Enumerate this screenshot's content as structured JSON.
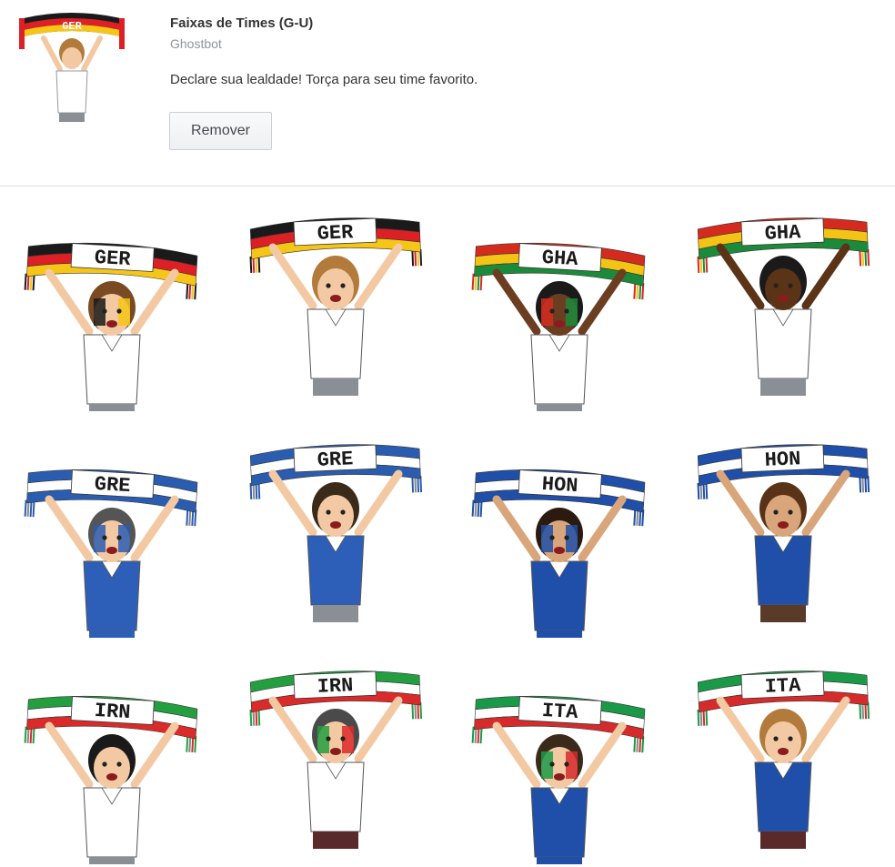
{
  "pack": {
    "title": "Faixas de Times (G-U)",
    "author": "Ghostbot",
    "description": "Declare sua lealdade! Torça para seu time favorito.",
    "remove_label": "Remover",
    "thumbnail_scarf_text": "GER"
  },
  "stickers": [
    {
      "text": "GER",
      "stripes": [
        "#1a1a1a",
        "#dd1f26",
        "#f5c518"
      ],
      "shirt": "#ffffff",
      "pants": "#8a8f96",
      "skin": "#f3c9a4",
      "hair": "#7a4a22",
      "facepaint": true
    },
    {
      "text": "GER",
      "stripes": [
        "#1a1a1a",
        "#dd1f26",
        "#f5c518"
      ],
      "shirt": "#ffffff",
      "pants": "#8a8f96",
      "skin": "#f3c9a4",
      "hair": "#b27b3c",
      "facepaint": false
    },
    {
      "text": "GHA",
      "stripes": [
        "#d52b1e",
        "#f3c316",
        "#1b8a3a"
      ],
      "shirt": "#ffffff",
      "pants": "#8a8f96",
      "skin": "#6b3e22",
      "hair": "#1a1a1a",
      "facepaint": true
    },
    {
      "text": "GHA",
      "stripes": [
        "#d52b1e",
        "#f3c316",
        "#1b8a3a"
      ],
      "shirt": "#ffffff",
      "pants": "#8a8f96",
      "skin": "#5b3418",
      "hair": "#1a1a1a",
      "facepaint": false
    },
    {
      "text": "GRE",
      "stripes": [
        "#2a5db0",
        "#ffffff",
        "#2a5db0"
      ],
      "shirt": "#2e5fb8",
      "pants": "#2e5fb8",
      "skin": "#f3c9a4",
      "hair": "#555555",
      "facepaint": true
    },
    {
      "text": "GRE",
      "stripes": [
        "#2a5db0",
        "#ffffff",
        "#2a5db0"
      ],
      "shirt": "#2e5fb8",
      "pants": "#8a8f96",
      "skin": "#f3c9a4",
      "hair": "#3a2a1a",
      "facepaint": false
    },
    {
      "text": "HON",
      "stripes": [
        "#1f4fa8",
        "#ffffff",
        "#1f4fa8"
      ],
      "shirt": "#1f4fa8",
      "pants": "#1f4fa8",
      "skin": "#d9a57b",
      "hair": "#2a1a10",
      "facepaint": true
    },
    {
      "text": "HON",
      "stripes": [
        "#1f4fa8",
        "#ffffff",
        "#1f4fa8"
      ],
      "shirt": "#1f4fa8",
      "pants": "#5a3a28",
      "skin": "#d9a57b",
      "hair": "#5a3218",
      "facepaint": false
    },
    {
      "text": "IRN",
      "stripes": [
        "#239f40",
        "#ffffff",
        "#da2a2a"
      ],
      "shirt": "#ffffff",
      "pants": "#8a8f96",
      "skin": "#f3c9a4",
      "hair": "#1a1a1a",
      "facepaint": false
    },
    {
      "text": "IRN",
      "stripes": [
        "#239f40",
        "#ffffff",
        "#da2a2a"
      ],
      "shirt": "#ffffff",
      "pants": "#5a2a2a",
      "skin": "#f3c9a4",
      "hair": "#4a4a4a",
      "facepaint": true
    },
    {
      "text": "ITA",
      "stripes": [
        "#1a9a48",
        "#ffffff",
        "#d52b2b"
      ],
      "shirt": "#1f4fa8",
      "pants": "#1f4fa8",
      "skin": "#f3c9a4",
      "hair": "#3a2a1a",
      "facepaint": true
    },
    {
      "text": "ITA",
      "stripes": [
        "#1a9a48",
        "#ffffff",
        "#d52b2b"
      ],
      "shirt": "#1f4fa8",
      "pants": "#5a2a2a",
      "skin": "#f3c9a4",
      "hair": "#b27b3c",
      "facepaint": false
    }
  ]
}
